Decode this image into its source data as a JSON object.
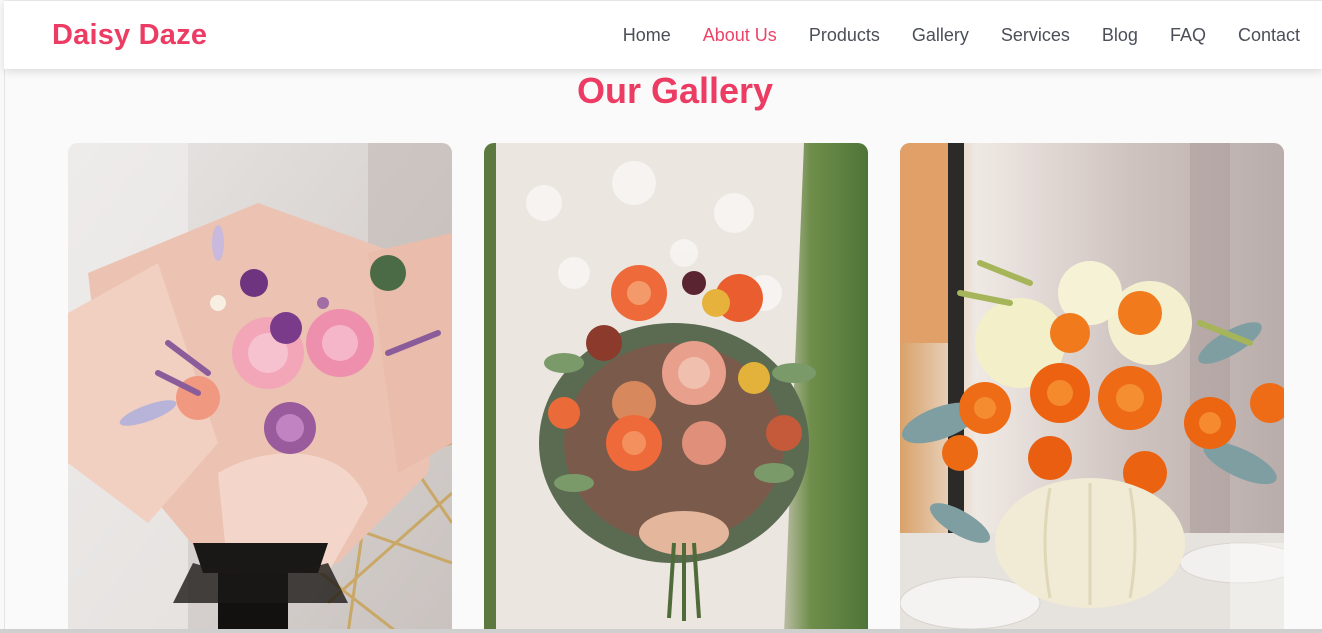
{
  "brand": {
    "name": "Daisy Daze",
    "color": "#ec3c63"
  },
  "nav": {
    "items": [
      {
        "label": "Home",
        "name": "nav-home",
        "active": false
      },
      {
        "label": "About Us",
        "name": "nav-about-us",
        "active": true
      },
      {
        "label": "Products",
        "name": "nav-products",
        "active": false
      },
      {
        "label": "Gallery",
        "name": "nav-gallery",
        "active": false
      },
      {
        "label": "Services",
        "name": "nav-services",
        "active": false
      },
      {
        "label": "Blog",
        "name": "nav-blog",
        "active": false
      },
      {
        "label": "FAQ",
        "name": "nav-faq",
        "active": false
      },
      {
        "label": "Contact",
        "name": "nav-contact",
        "active": false
      }
    ],
    "active_color": "#ec4468",
    "text_color": "#4b4f58"
  },
  "gallery": {
    "title": "Our Gallery",
    "images": [
      {
        "subject": "pink wrapped bouquet of roses and dried flowers"
      },
      {
        "subject": "bride holding orange dahlia bridal bouquet"
      },
      {
        "subject": "orange ranunculus centerpiece in white pumpkin"
      }
    ]
  }
}
